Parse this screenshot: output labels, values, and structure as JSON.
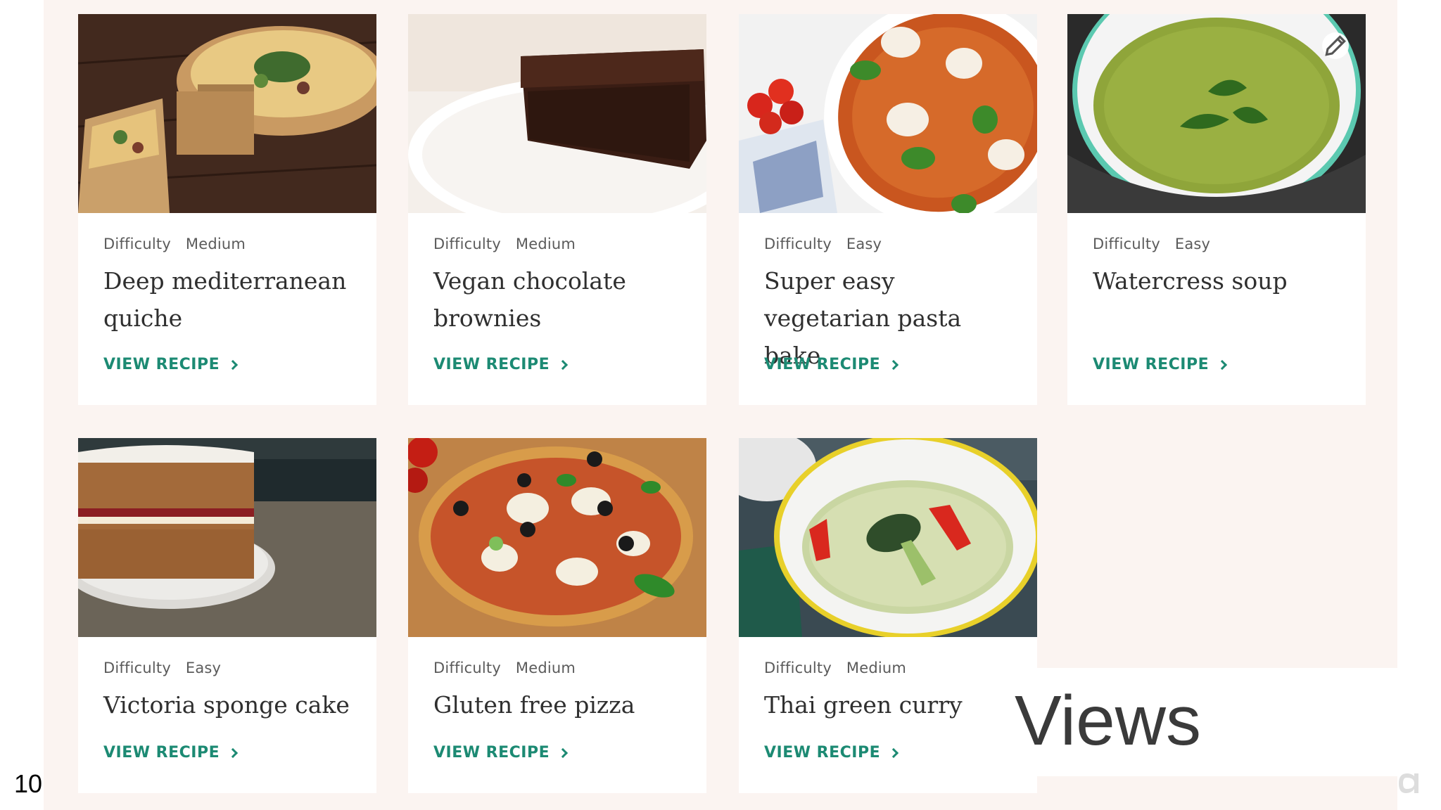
{
  "recipes": [
    {
      "difficulty_label": "Difficulty",
      "difficulty": "Medium",
      "title": "Deep mediterranean quiche",
      "cta": "VIEW RECIPE",
      "image": "quiche-photo"
    },
    {
      "difficulty_label": "Difficulty",
      "difficulty": "Medium",
      "title": "Vegan chocolate brownies",
      "cta": "VIEW RECIPE",
      "image": "brownie-photo"
    },
    {
      "difficulty_label": "Difficulty",
      "difficulty": "Easy",
      "title": "Super easy vegetarian pasta bake",
      "cta": "VIEW RECIPE",
      "image": "pasta-bake-photo"
    },
    {
      "difficulty_label": "Difficulty",
      "difficulty": "Easy",
      "title": "Watercress soup",
      "cta": "VIEW RECIPE",
      "image": "soup-photo"
    },
    {
      "difficulty_label": "Difficulty",
      "difficulty": "Easy",
      "title": "Victoria sponge cake",
      "cta": "VIEW RECIPE",
      "image": "sponge-cake-photo"
    },
    {
      "difficulty_label": "Difficulty",
      "difficulty": "Medium",
      "title": "Gluten free pizza",
      "cta": "VIEW RECIPE",
      "image": "pizza-photo"
    },
    {
      "difficulty_label": "Difficulty",
      "difficulty": "Medium",
      "title": "Thai green curry",
      "cta": "VIEW RECIPE",
      "image": "curry-photo"
    }
  ],
  "overlay": {
    "views_label": "Views",
    "slide_number": "10"
  },
  "colors": {
    "accent": "#1c8a73",
    "page_background": "#fbf4f1",
    "card_background": "#ffffff"
  },
  "icons": {
    "edit": "pencil-icon",
    "cta": "chevron-right-icon"
  }
}
